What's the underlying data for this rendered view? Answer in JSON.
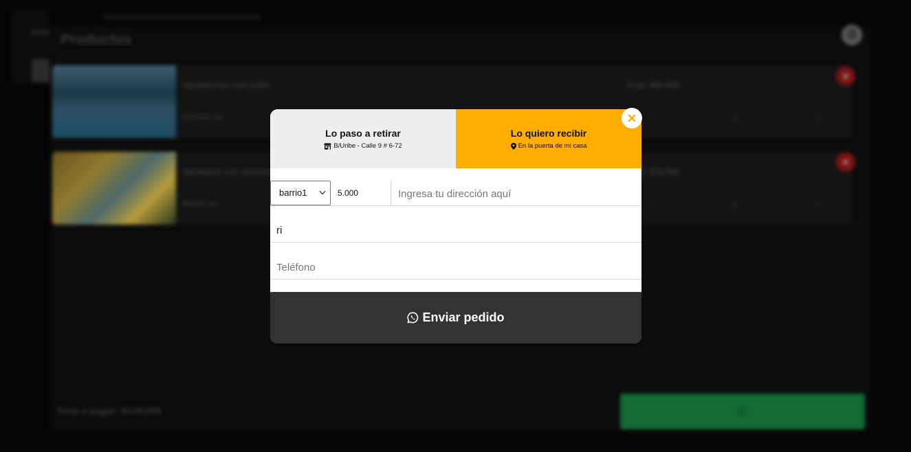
{
  "background": {
    "title": "Productos",
    "products": [
      {
        "name": "Sándwiches con pollo",
        "price": "$12.000 c/u",
        "total": "Total: $60.000",
        "qty": "0"
      },
      {
        "name": "Sándwich con chicharrón",
        "price": "$9000 c/u",
        "total": "Total: $18.000",
        "qty": "0"
      }
    ],
    "grand_total": "Total a pagar: $134.000"
  },
  "modal": {
    "pickup_tab": {
      "title": "Lo paso a retirar",
      "subtitle": "B/Uribe - Calle 9 # 6-72",
      "icon": "store-icon"
    },
    "delivery_tab": {
      "title": "Lo quiero recibir",
      "subtitle": "En la puerta de mi casa",
      "icon": "map-marker-icon"
    },
    "barrio": {
      "selected": "barrio1"
    },
    "delivery_price": "5.000",
    "address": {
      "value": "",
      "placeholder": "Ingresa tu dirección aquí"
    },
    "name": {
      "value": "ri"
    },
    "phone": {
      "value": "",
      "placeholder": "Teléfono"
    },
    "send_label": "Enviar pedido",
    "close_icon": "close-icon"
  },
  "colors": {
    "accent": "#ffad00",
    "send_bar": "#333333",
    "close_x": "#ffad00",
    "whatsapp_green": "#146b35",
    "delete_red": "#7a1414"
  }
}
